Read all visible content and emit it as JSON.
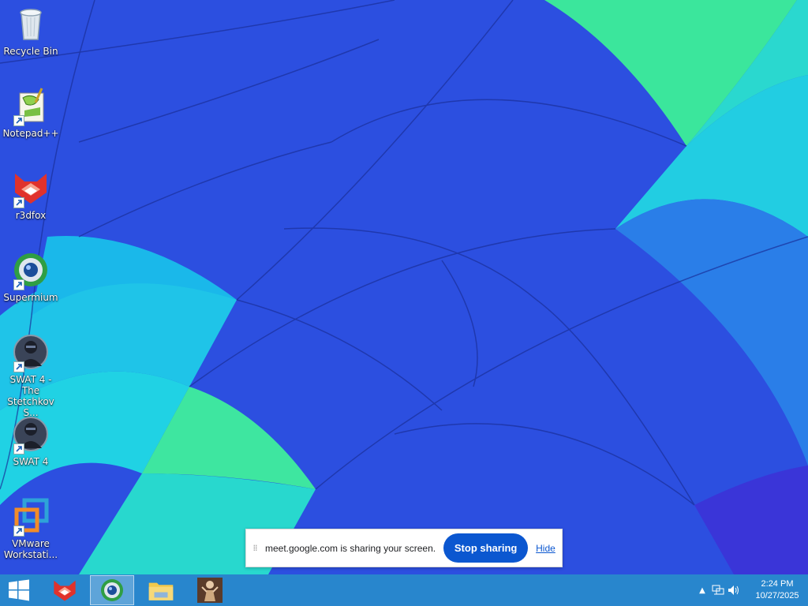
{
  "desktop": {
    "icons": [
      {
        "label": "Recycle Bin",
        "icon": "recycle-bin-icon"
      },
      {
        "label": "Notepad++",
        "icon": "notepad-plus-plus-icon"
      },
      {
        "label": "r3dfox",
        "icon": "r3dfox-icon"
      },
      {
        "label": "Supermium",
        "icon": "supermium-icon"
      },
      {
        "label": "SWAT 4 - The Stetchkov S...",
        "icon": "swat4-stetchkov-icon"
      },
      {
        "label": "SWAT 4",
        "icon": "swat4-icon"
      },
      {
        "label": "VMware Workstati...",
        "icon": "vmware-workstation-icon"
      }
    ]
  },
  "share_bar": {
    "message": "meet.google.com is sharing your screen.",
    "stop_label": "Stop sharing",
    "hide_label": "Hide",
    "accent": "#0b57d0"
  },
  "taskbar": {
    "pinned": [
      {
        "icon": "start-icon"
      },
      {
        "icon": "r3dfox-icon"
      },
      {
        "icon": "supermium-icon",
        "active": true
      },
      {
        "icon": "file-explorer-icon"
      },
      {
        "icon": "app-figure-icon"
      }
    ],
    "tray": {
      "time": "2:24 PM",
      "date": "10/27/2025"
    }
  }
}
